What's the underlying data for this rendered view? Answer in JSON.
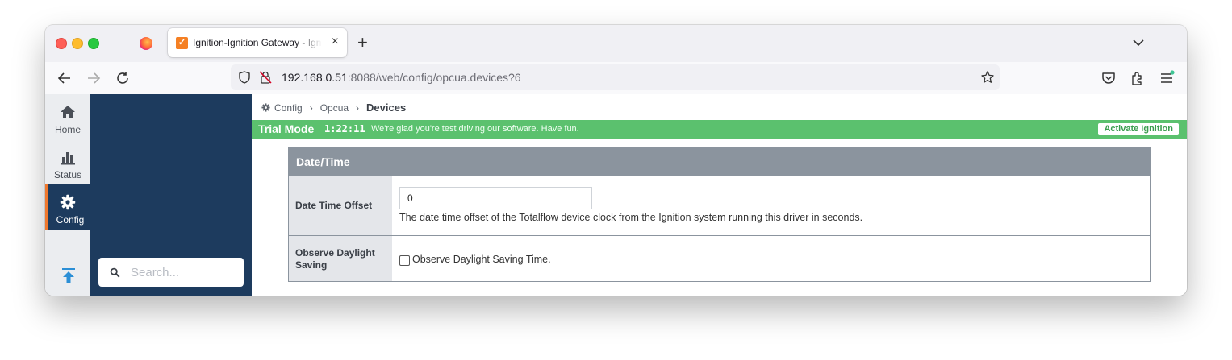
{
  "browser": {
    "tab_title": "Ignition-Ignition Gateway - Ignition",
    "url_host": "192.168.0.51",
    "url_rest": ":8088/web/config/opcua.devices?6"
  },
  "sidebar": {
    "items": [
      {
        "label": "Home",
        "icon": "home-icon"
      },
      {
        "label": "Status",
        "icon": "bar-chart-icon"
      },
      {
        "label": "Config",
        "icon": "gear-icon",
        "active": true
      }
    ],
    "search_placeholder": "Search..."
  },
  "breadcrumb": {
    "items": [
      "Config",
      "Opcua"
    ],
    "current": "Devices"
  },
  "trial": {
    "mode": "Trial Mode",
    "time": "1:22:11",
    "message": "We're glad you're test driving our software. Have fun.",
    "activate": "Activate Ignition"
  },
  "form": {
    "section_title": "Date/Time",
    "fields": [
      {
        "label": "Date Time Offset",
        "value": "0",
        "help": "The date time offset of the Totalflow device clock from the Ignition system running this driver in seconds."
      },
      {
        "label_line1": "Observe Daylight",
        "label_line2": "Saving",
        "checkbox_label": "Observe Daylight Saving Time.",
        "checked": false
      }
    ]
  },
  "colors": {
    "sidebar_dark": "#1d3b5e",
    "trial_green": "#5bc16e",
    "accent_orange": "#f0782d",
    "section_header": "#8b949e"
  }
}
